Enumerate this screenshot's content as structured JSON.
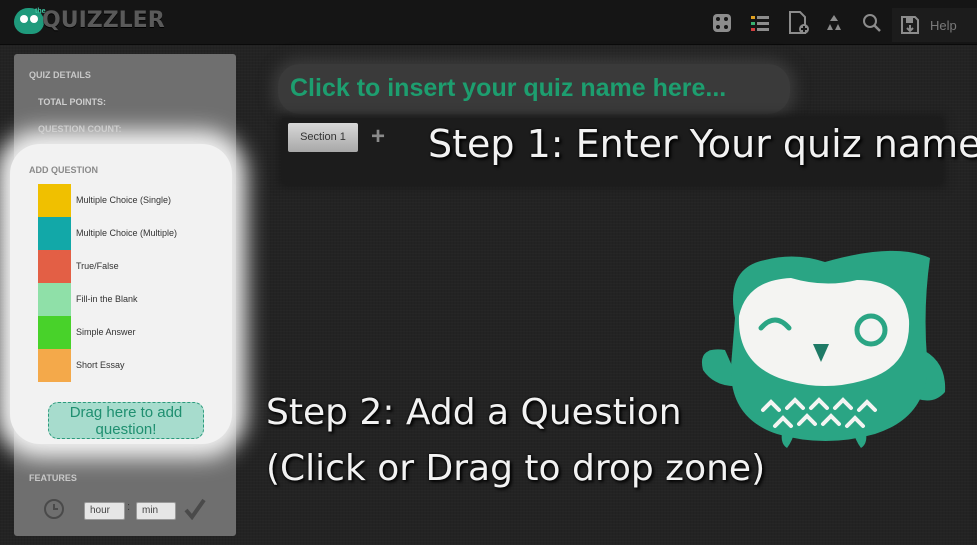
{
  "app": {
    "logo_small": "the",
    "logo_text": "QUIZZLER"
  },
  "toolbar": {
    "icons": [
      "dice-icon",
      "list-icon",
      "new-document-icon",
      "recycle-icon",
      "search-icon",
      "save-icon"
    ],
    "help_label": "Help"
  },
  "sidebar": {
    "quiz_details_label": "QUIZ DETAILS",
    "total_points_label": "TOTAL POINTS:",
    "question_count_label": "QUESTION COUNT:",
    "add_question_label": "ADD QUESTION",
    "question_types": [
      {
        "label": "Multiple Choice (Single)",
        "color": "#f0c000"
      },
      {
        "label": "Multiple Choice (Multiple)",
        "color": "#12a8a8"
      },
      {
        "label": "True/False",
        "color": "#e35f45"
      },
      {
        "label": "Fill-in the Blank",
        "color": "#8fe0a8"
      },
      {
        "label": "Simple Answer",
        "color": "#48d22a"
      },
      {
        "label": "Short Essay",
        "color": "#f4a94a"
      }
    ],
    "dropzone_label": "Drag here to add question!",
    "features_label": "FEATURES",
    "hour_placeholder": "hour",
    "time_separator": ":",
    "min_placeholder": "min"
  },
  "main": {
    "quiz_title_placeholder": "Click to insert your quiz name here...",
    "section_tab_label": "Section 1",
    "add_section_symbol": "+",
    "step1_text": "Step 1: Enter Your quiz name",
    "step2_line1": "Step 2: Add a Question",
    "step2_line2": "(Click or Drag to drop zone)"
  },
  "colors": {
    "accent": "#1d9e6f",
    "owl_green": "#2aa584"
  }
}
